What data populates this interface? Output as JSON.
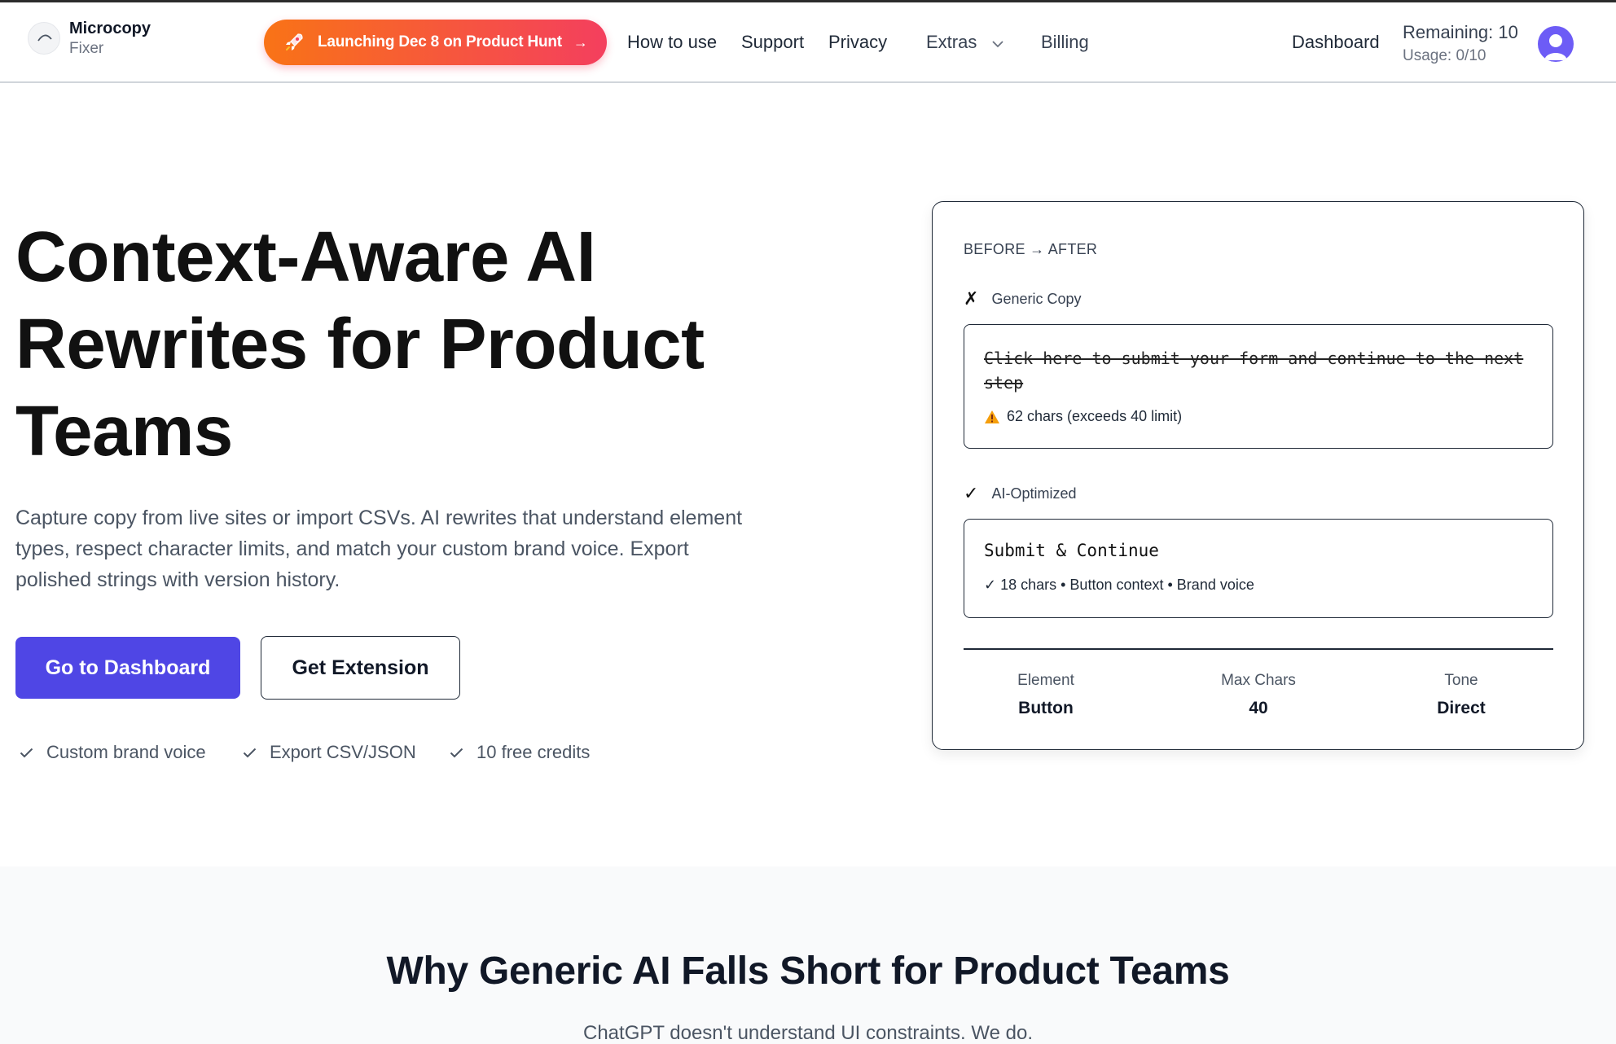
{
  "header": {
    "brand_line1": "Microcopy",
    "brand_line2": "Fixer",
    "launch_banner": "Launching Dec 8 on Product Hunt",
    "launch_arrow": "→",
    "nav": [
      "How to use",
      "Support",
      "Privacy",
      "Extras",
      "Billing"
    ],
    "dashboard": "Dashboard",
    "remaining": "Remaining: 10",
    "usage": "Usage: 0/10"
  },
  "hero": {
    "title": "Context-Aware AI Rewrites for Product Teams",
    "subtitle": "Capture copy from live sites or import CSVs. AI rewrites that understand element types, respect character limits, and match your custom brand voice. Export polished strings with version history.",
    "primary_cta": "Go to Dashboard",
    "secondary_cta": "Get Extension",
    "features": [
      "Custom brand voice",
      "Export CSV/JSON",
      "10 free credits"
    ]
  },
  "card": {
    "eyebrow": "BEFORE → AFTER",
    "before_mark": "✗",
    "before_label": "Generic Copy",
    "before_text": "Click here to submit your form and continue to the next step",
    "before_warning": "62 chars (exceeds 40 limit)",
    "after_mark": "✓",
    "after_label": "AI-Optimized",
    "after_text": "Submit & Continue",
    "after_meta": "✓ 18 chars • Button context • Brand voice",
    "stats": [
      {
        "label": "Element",
        "value": "Button"
      },
      {
        "label": "Max Chars",
        "value": "40"
      },
      {
        "label": "Tone",
        "value": "Direct"
      }
    ]
  },
  "section2": {
    "title": "Why Generic AI Falls Short for Product Teams",
    "subtitle": "ChatGPT doesn't understand UI constraints. We do."
  },
  "colors": {
    "primary": "#4f46e5",
    "banner_start": "#f97316",
    "banner_end": "#f43f5e",
    "avatar": "#6d5cf6"
  }
}
